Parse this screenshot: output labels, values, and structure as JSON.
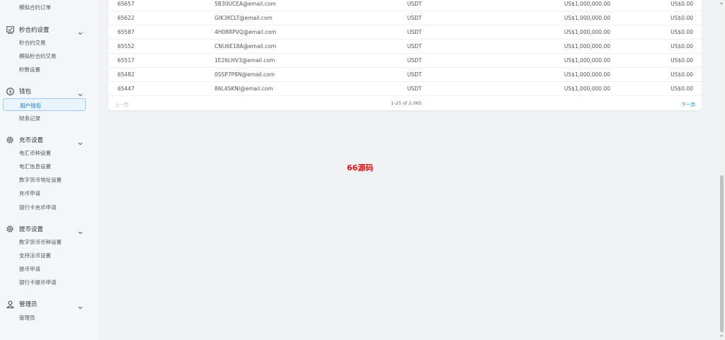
{
  "sidebar": {
    "top_item": "模拟合约订单",
    "sections": [
      {
        "title": "秒合约设置",
        "icon": "chart-check-icon",
        "items": [
          "秒合约交易",
          "模拟秒合约交易",
          "秒数设置"
        ]
      },
      {
        "title": "钱包",
        "icon": "dollar-circle-icon",
        "items": [
          "用户钱包",
          "财务记录"
        ]
      },
      {
        "title": "充币设置",
        "icon": "gear-icon",
        "items": [
          "电汇币种设置",
          "电汇信息设置",
          "数字货币地址设置",
          "充币申请",
          "银行卡充币申请"
        ]
      },
      {
        "title": "提币设置",
        "icon": "gear-icon",
        "items": [
          "数字货币币种设置",
          "支持法币设置",
          "提币申请",
          "银行卡提币申请"
        ]
      },
      {
        "title": "管理员",
        "icon": "user-icon",
        "items": [
          "管理员"
        ]
      }
    ],
    "active_item": "用户钱包"
  },
  "table": {
    "rows": [
      {
        "id": "65657",
        "email": "5B30UCEA@email.com",
        "currency": "USDT",
        "balance": "US$1,000,000.00",
        "fee": "US$0.00"
      },
      {
        "id": "65622",
        "email": "GIK3KCLT@email.com",
        "currency": "USDT",
        "balance": "US$1,000,000.00",
        "fee": "US$0.00"
      },
      {
        "id": "65587",
        "email": "4H08RPVQ@email.com",
        "currency": "USDT",
        "balance": "US$1,000,000.00",
        "fee": "US$0.00"
      },
      {
        "id": "65552",
        "email": "CNU6E18A@email.com",
        "currency": "USDT",
        "balance": "US$1,000,000.00",
        "fee": "US$0.00"
      },
      {
        "id": "65517",
        "email": "1E26LHV3@email.com",
        "currency": "USDT",
        "balance": "US$1,000,000.00",
        "fee": "US$0.00"
      },
      {
        "id": "65482",
        "email": "0SSP7P8N@email.com",
        "currency": "USDT",
        "balance": "US$1,000,000.00",
        "fee": "US$0.00"
      },
      {
        "id": "65447",
        "email": "86L4SKNI@email.com",
        "currency": "USDT",
        "balance": "US$1,000,000.00",
        "fee": "US$0.00"
      }
    ]
  },
  "pagination": {
    "prev_label": "上一页",
    "info": "1-25 of 2,065",
    "next_label": "下一页"
  },
  "watermark": "66源码",
  "colors": {
    "accent": "#1a6fd1",
    "watermark": "#e01010",
    "background": "#f0f2f5"
  }
}
